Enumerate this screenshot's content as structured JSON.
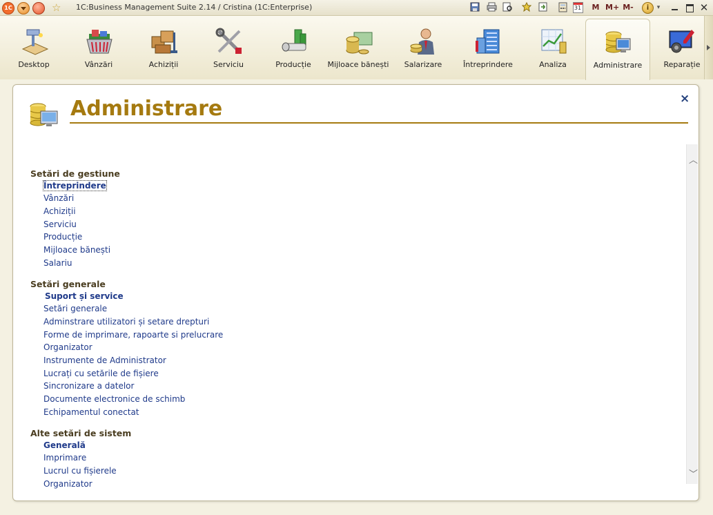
{
  "window": {
    "title": "1C:Business Management Suite 2.14 / Cristina  (1C:Enterprise)",
    "logo_text": "1C",
    "memory_buttons": [
      "M",
      "M+",
      "M-"
    ],
    "calendar_day": "31"
  },
  "sections": [
    {
      "label": "Desktop",
      "icon": "desktop-icon"
    },
    {
      "label": "Vânzări",
      "icon": "sales-basket-icon"
    },
    {
      "label": "Achiziții",
      "icon": "purchases-boxes-icon"
    },
    {
      "label": "Serviciu",
      "icon": "service-tools-icon"
    },
    {
      "label": "Producție",
      "icon": "production-icon"
    },
    {
      "label": "Mijloace bănești",
      "icon": "money-coins-icon"
    },
    {
      "label": "Salarizare",
      "icon": "payroll-person-icon"
    },
    {
      "label": "Întreprindere",
      "icon": "enterprise-building-icon"
    },
    {
      "label": "Analiza",
      "icon": "analysis-chart-icon"
    },
    {
      "label": "Administrare",
      "icon": "administration-db-icon",
      "active": true
    },
    {
      "label": "Reparație",
      "icon": "repair-monitor-icon"
    }
  ],
  "page": {
    "title": "Administrare",
    "close_symbol": "×"
  },
  "groups": [
    {
      "title": "Setări de gestiune",
      "links": [
        "Întreprindere",
        "Vânzări",
        "Achiziții",
        "Serviciu",
        "Producție",
        "Mijloace bănești",
        "Salariu"
      ]
    },
    {
      "title": "Setări generale",
      "links": [
        "Suport și service",
        "Setări generale",
        "Adminstrare utilizatori și setare drepturi",
        "Forme de imprimare, rapoarte si prelucrare",
        "Organizator",
        "Instrumente de Administrator",
        "Lucrați cu setările de fișiere",
        "Sincronizare a datelor",
        "Documente electronice de schimb",
        "Echipamentul conectat"
      ]
    },
    {
      "title": "Alte setări de sistem",
      "links": [
        "Generală",
        "Imprimare",
        "Lucrul cu fișierele",
        "Organizator"
      ]
    }
  ],
  "colors": {
    "title_gold": "#a57a10",
    "link_blue": "#1f3a8a",
    "group_brown": "#4a3d20"
  }
}
